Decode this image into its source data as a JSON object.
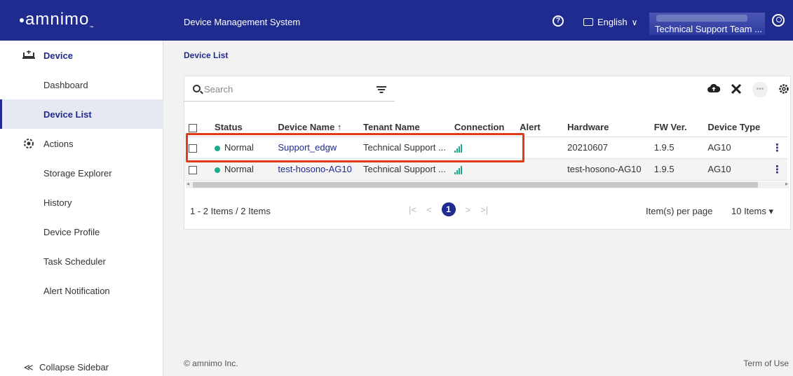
{
  "header": {
    "logo": "amnimo",
    "title": "Device Management System",
    "language": "English",
    "team": "Technical Support Team ..."
  },
  "sidebar": {
    "items": [
      {
        "label": "Device",
        "icon": "device-icon"
      },
      {
        "label": "Dashboard"
      },
      {
        "label": "Device List"
      },
      {
        "label": "Actions",
        "icon": "gear-actions-icon"
      },
      {
        "label": "Storage Explorer"
      },
      {
        "label": "History"
      },
      {
        "label": "Device Profile"
      },
      {
        "label": "Task Scheduler"
      },
      {
        "label": "Alert Notification"
      }
    ],
    "collapse_label": "Collapse Sidebar"
  },
  "breadcrumb": "Device List",
  "search": {
    "placeholder": "Search",
    "value": ""
  },
  "table": {
    "headers": [
      "Status",
      "Device Name ↑",
      "Tenant Name",
      "Connection",
      "Alert",
      "Hardware",
      "FW Ver.",
      "Device Type"
    ],
    "rows": [
      {
        "status": "Normal",
        "device_name": "Support_edgw",
        "tenant": "Technical Support ...",
        "alert": "",
        "hardware": "20210607",
        "fw": "1.9.5",
        "type": "AG10"
      },
      {
        "status": "Normal",
        "device_name": "test-hosono-AG10",
        "tenant": "Technical Support ...",
        "alert": "",
        "hardware": "test-hosono-AG10",
        "fw": "1.9.5",
        "type": "AG10"
      }
    ]
  },
  "pagination": {
    "count_text": "1 - 2 Items / 2 Items",
    "current_page": "1",
    "per_page_label": "Item(s) per page",
    "per_page_value": "10 Items"
  },
  "footer": {
    "copyright": "© amnimo Inc.",
    "terms": "Term of Use"
  },
  "colors": {
    "brand": "#1f2b8e",
    "status_normal": "#1aaa8c",
    "highlight": "#e03a16"
  }
}
